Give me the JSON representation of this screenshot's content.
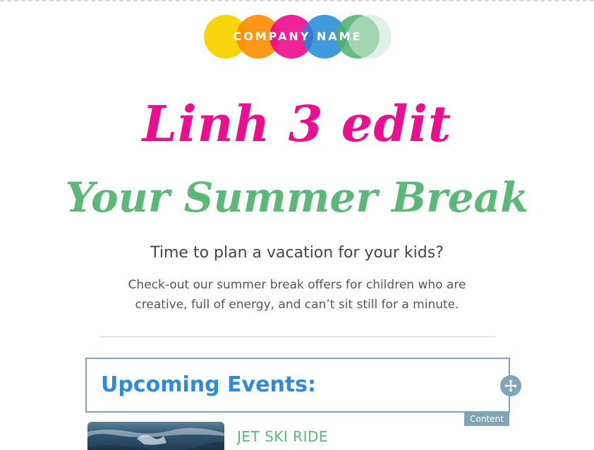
{
  "logo": {
    "text": "COMPANY NAME",
    "colors": [
      "#f5d300",
      "#ff8c00",
      "#ec0b8d",
      "#1e88d6",
      "#4caf6a",
      "#c9e8d2"
    ]
  },
  "hero": {
    "title": "Linh 3 edit",
    "subtitle": "Your Summer Break",
    "tagline": "Time to plan a vacation for your kids?",
    "description": "Check-out our summer break offers for children who are creative, full of energy, and can’t sit still for a minute."
  },
  "events_section": {
    "heading": "Upcoming Events:",
    "editor_tag": "Content",
    "move_icon": "move-arrows-icon",
    "items": [
      {
        "title": "JET SKI RIDE",
        "image": "ocean-wave-photo"
      }
    ]
  },
  "colors": {
    "title_pink": "#ea0f8f",
    "subtitle_green": "#5cb879",
    "heading_blue": "#2e8bd6",
    "editor_accent": "#7fa5b6"
  }
}
